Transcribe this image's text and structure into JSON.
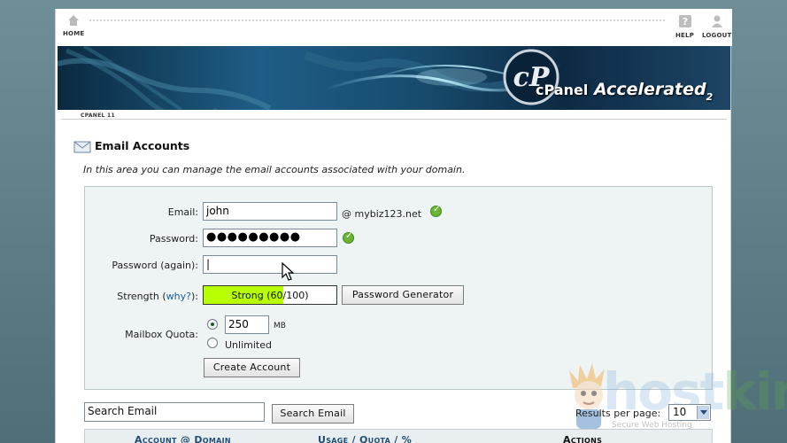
{
  "nav": {
    "home": "HOME",
    "help": "HELP",
    "logout": "LOGOUT"
  },
  "banner": {
    "brand_cp": "cPanel",
    "brand_accel": "Accelerated",
    "brand_num": "2"
  },
  "breadcrumb": "CPANEL 11",
  "page": {
    "title": "Email Accounts",
    "intro": "In this area you can manage the email accounts associated with your domain."
  },
  "form": {
    "email_label": "Email:",
    "email_value": "john",
    "domain": "@ mybiz123.net",
    "password_label": "Password:",
    "password_value": "●●●●●●●●●",
    "password_again_label": "Password (again):",
    "password_again_value": "|",
    "strength_label": "Strength (",
    "strength_why": "why?",
    "strength_close": "):",
    "strength_text": "Strong (60/100)",
    "strength_value": 60,
    "strength_color": "#b8ff00",
    "password_generator": "Password Generator",
    "quota_label": "Mailbox Quota:",
    "quota_value": "250",
    "quota_unit": "MB",
    "quota_unlimited": "Unlimited",
    "create_account": "Create Account"
  },
  "search": {
    "placeholder": "Search Email",
    "button": "Search Email",
    "rpp_label": "Results per page:",
    "rpp_value": "10"
  },
  "table": {
    "col_account": "Account @ Domain",
    "col_usage": "Usage / Quota / %",
    "col_actions": "Actions"
  },
  "watermark": {
    "host": "host",
    "king": "king",
    "sub": "Secure Web Hosting"
  },
  "colors": {
    "accent_link": "#1b5da0",
    "check_green": "#6bb536",
    "panel_bg": "#eef3f3"
  }
}
